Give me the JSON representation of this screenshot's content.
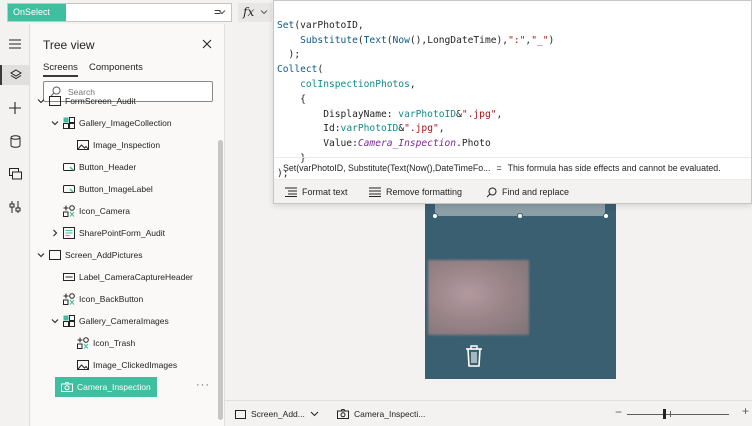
{
  "formula_bar": {
    "property": "OnSelect",
    "equals": "=",
    "fx": "fx"
  },
  "tree": {
    "title": "Tree view",
    "tabs": [
      "Screens",
      "Components"
    ],
    "search_placeholder": "Search",
    "items": [
      {
        "label": "FormScreen_Audit",
        "icon": "screen-icon",
        "expanded": true
      },
      {
        "label": "Gallery_ImageCollection",
        "icon": "gallery-icon",
        "expanded": true
      },
      {
        "label": "Image_Inspection",
        "icon": "image-icon"
      },
      {
        "label": "Button_Header",
        "icon": "button-icon"
      },
      {
        "label": "Button_ImageLabel",
        "icon": "button-icon"
      },
      {
        "label": "Icon_Camera",
        "icon": "icon-control-icon"
      },
      {
        "label": "SharePointForm_Audit",
        "icon": "form-icon",
        "expanded": false
      },
      {
        "label": "Screen_AddPictures",
        "icon": "screen-icon",
        "expanded": true
      },
      {
        "label": "Label_CameraCaptureHeader",
        "icon": "label-icon"
      },
      {
        "label": "Icon_BackButton",
        "icon": "icon-control-icon"
      },
      {
        "label": "Gallery_CameraImages",
        "icon": "gallery-icon",
        "expanded": true
      },
      {
        "label": "Icon_Trash",
        "icon": "icon-control-icon"
      },
      {
        "label": "Image_ClickedImages",
        "icon": "image-icon"
      },
      {
        "label": "Camera_Inspection",
        "icon": "camera-icon",
        "selected": true
      }
    ],
    "ellipsis": "···"
  },
  "editor": {
    "code_lines": [
      "Set(varPhotoID,",
      "    Substitute(Text(Now(),LongDateTime),\":\",\"_\")",
      "  );",
      "Collect(",
      "    colInspectionPhotos,",
      "    {",
      "        DisplayName: varPhotoID&\".jpg\",",
      "        Id:varPhotoID&\".jpg\",",
      "        Value:Camera_Inspection.Photo",
      "    }",
      ");"
    ],
    "result_formula": "Set(varPhotoID, Substitute(Text(Now(),DateTimeFo...",
    "result_equals": "=",
    "result_message": "This formula has side effects and cannot be evaluated.",
    "tools": [
      "Format text",
      "Remove formatting",
      "Find and replace"
    ]
  },
  "bottom": {
    "screen_crumb": "Screen_Add...",
    "control_crumb": "Camera_Inspecti...",
    "zoom_minus": "−",
    "zoom_plus": "+"
  },
  "colors": {
    "accent": "#3fbf9f",
    "screen_bg": "#3a5f71"
  }
}
